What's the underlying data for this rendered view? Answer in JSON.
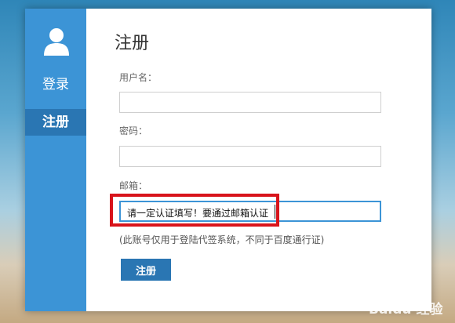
{
  "sidebar": {
    "avatar_icon": "user-icon",
    "items": [
      {
        "label": "登录",
        "active": false
      },
      {
        "label": "注册",
        "active": true
      }
    ]
  },
  "form": {
    "title": "注册",
    "username_label": "用户名：",
    "username_value": "",
    "password_label": "密码：",
    "password_value": "",
    "email_label": "邮箱：",
    "email_value": "请一定认证填写！要通过邮箱认证",
    "email_hint": "(此账号仅用于登陆代签系统，不同于百度通行证)",
    "submit_label": "注册"
  },
  "watermark": "Baidu 经验",
  "colors": {
    "sidebar": "#3c94d6",
    "sidebar_active": "#2a76b3",
    "highlight": "#d8141b"
  }
}
